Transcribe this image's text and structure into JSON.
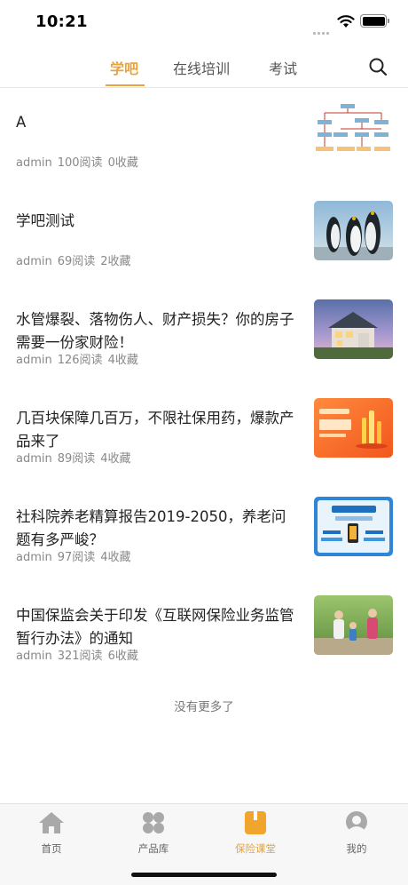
{
  "status": {
    "time": "10:21"
  },
  "tabs": [
    {
      "label": "学吧",
      "active": true
    },
    {
      "label": "在线培训",
      "active": false
    },
    {
      "label": "考试",
      "active": false
    }
  ],
  "accent_color": "#e8a33a",
  "articles": [
    {
      "title": "A",
      "author": "admin",
      "reads": "100阅读",
      "favorites": "0收藏",
      "thumb": "flowchart diagram"
    },
    {
      "title": "学吧测试",
      "author": "admin",
      "reads": "69阅读",
      "favorites": "2收藏",
      "thumb": "penguins"
    },
    {
      "title": "水管爆裂、落物伤人、财产损失？你的房子需要一份家财险！",
      "author": "admin",
      "reads": "126阅读",
      "favorites": "4收藏",
      "thumb": "house at dusk"
    },
    {
      "title": "几百块保障几百万，不限社保用药，爆款产品来了",
      "author": "admin",
      "reads": "89阅读",
      "favorites": "4收藏",
      "thumb": "orange promo banner"
    },
    {
      "title": "社科院养老精算报告2019-2050，养老问题有多严峻？",
      "author": "admin",
      "reads": "97阅读",
      "favorites": "4收藏",
      "thumb": "blue pension banner"
    },
    {
      "title": "中国保监会关于印发《互联网保险业务监管暂行办法》的通知",
      "author": "admin",
      "reads": "321阅读",
      "favorites": "6收藏",
      "thumb": "family walking"
    }
  ],
  "footer_text": "没有更多了",
  "bottom_nav": [
    {
      "label": "首页",
      "icon": "home-icon",
      "active": false
    },
    {
      "label": "产品库",
      "icon": "grid-icon",
      "active": false
    },
    {
      "label": "保险课堂",
      "icon": "book-icon",
      "active": true
    },
    {
      "label": "我的",
      "icon": "user-icon",
      "active": false
    }
  ]
}
